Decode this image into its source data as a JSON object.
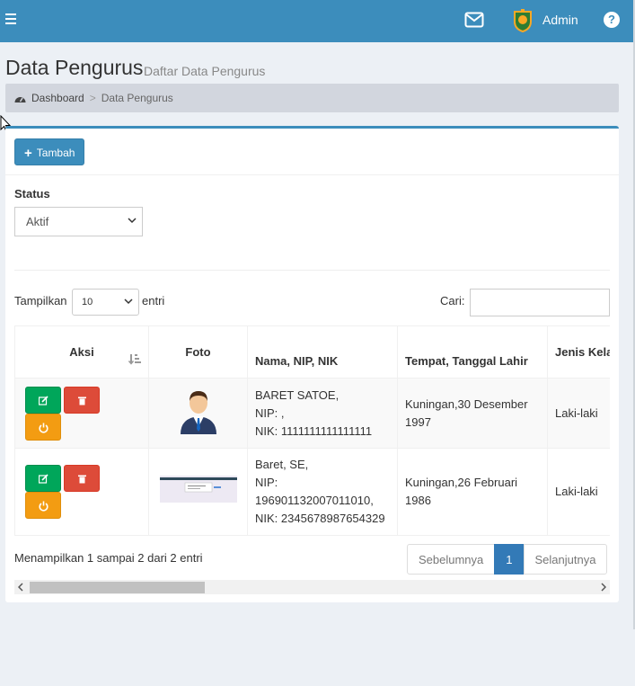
{
  "topbar": {
    "user_name": "Admin",
    "menu_icon": "hamburger-icon",
    "mail_icon": "envelope-icon",
    "help_icon": "question-circle-icon",
    "help_glyph": "?",
    "brand_color": "#3c8dbc"
  },
  "page": {
    "title": "Data Pengurus",
    "subtitle": "Daftar Data Pengurus"
  },
  "breadcrumb": {
    "home": "Dashboard",
    "separator": ">",
    "current": "Data Pengurus"
  },
  "toolbar": {
    "add_label": "Tambah"
  },
  "filter": {
    "label": "Status",
    "value": "Aktif"
  },
  "table_controls": {
    "length_prefix": "Tampilkan",
    "length_value": "10",
    "length_suffix": "entri",
    "search_label": "Cari:",
    "search_value": ""
  },
  "table": {
    "columns": [
      "Aksi",
      "Foto",
      "Nama, NIP, NIK",
      "Tempat, Tanggal Lahir",
      "Jenis Kelamin"
    ],
    "rows": [
      {
        "foto": "person-avatar",
        "nama": "BARET SATOE,",
        "nip": "NIP: ,",
        "nik": "NIK: 1111111111111111",
        "ttl": "Kuningan,30 Desember 1997",
        "jenis_kelamin": "Laki-laki"
      },
      {
        "foto": "document-screenshot",
        "nama": "Baret, SE,",
        "nip": "NIP: 196901132007011010,",
        "nik": "NIK: 2345678987654329",
        "ttl": "Kuningan,26 Februari 1986",
        "jenis_kelamin": "Laki-laki"
      }
    ]
  },
  "footer": {
    "info": "Menampilkan 1 sampai 2 dari 2 entri",
    "prev": "Sebelumnya",
    "page": "1",
    "next": "Selanjutnya"
  },
  "colors": {
    "edit": "#00a65a",
    "delete": "#dd4b39",
    "power": "#f39c12",
    "primary": "#337ab7"
  }
}
